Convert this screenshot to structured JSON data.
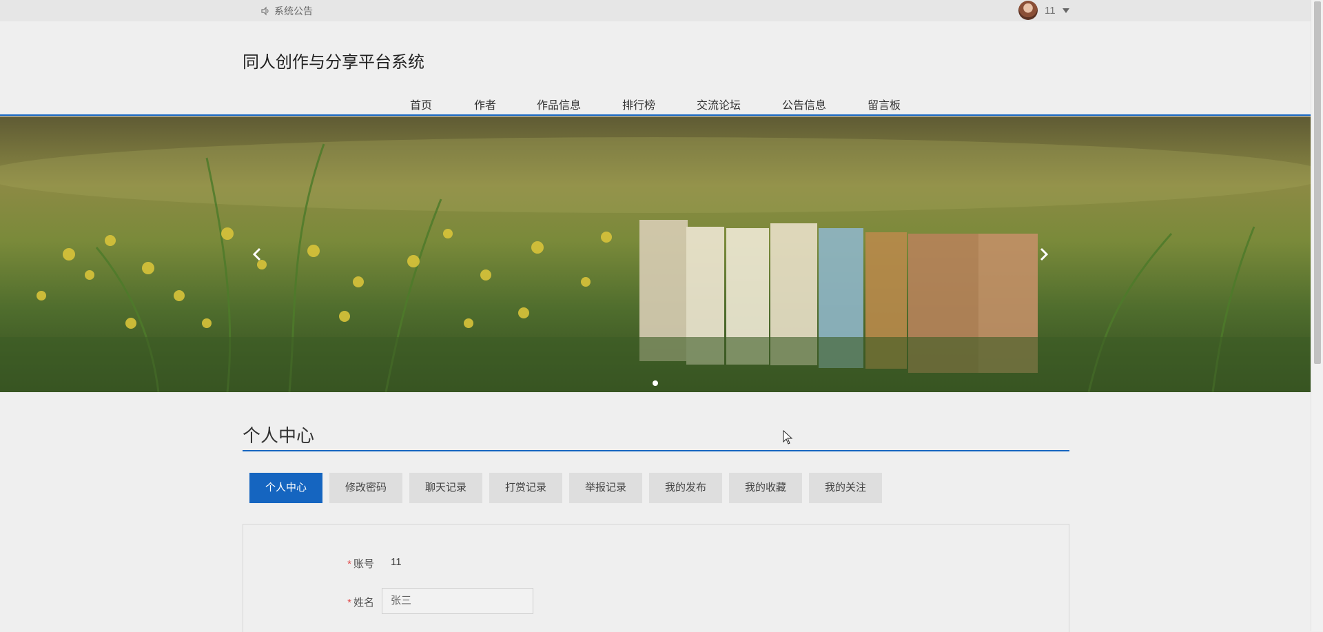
{
  "topbar": {
    "notice_label": "系统公告",
    "speaker_icon": "speaker-icon",
    "username": "11"
  },
  "header": {
    "site_title": "同人创作与分享平台系统",
    "nav": [
      "首页",
      "作者",
      "作品信息",
      "排行榜",
      "交流论坛",
      "公告信息",
      "留言板"
    ]
  },
  "banner": {
    "prev_icon": "chevron-left-icon",
    "next_icon": "chevron-right-icon",
    "slide_count": 1,
    "active_slide": 1
  },
  "section": {
    "title": "个人中心"
  },
  "tabs": [
    "个人中心",
    "修改密码",
    "聊天记录",
    "打赏记录",
    "举报记录",
    "我的发布",
    "我的收藏",
    "我的关注"
  ],
  "active_tab": "个人中心",
  "form": {
    "account_label": "账号",
    "account_value": "11",
    "name_label": "姓名",
    "name_value": "张三",
    "required_mark": "*"
  },
  "colors": {
    "accent": "#1565c0",
    "required": "#e04b4b"
  }
}
